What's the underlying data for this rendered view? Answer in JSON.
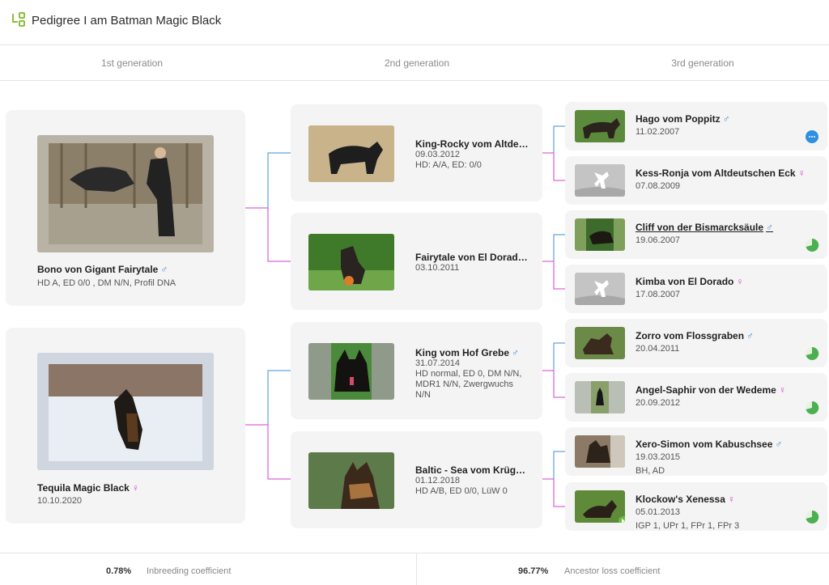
{
  "header": {
    "title": "Pedigree I am Batman Magic Black",
    "logo_icon": "pedigree-tree-icon"
  },
  "generations": [
    "1st generation",
    "2nd generation",
    "3rd generation"
  ],
  "gen1": [
    {
      "name": "Bono von Gigant Fairytale",
      "sex": "♂",
      "detail": "HD A, ED 0/0 , DM N/N, Profil DNA"
    },
    {
      "name": "Tequila Magic Black",
      "sex": "♀",
      "detail": "10.10.2020"
    }
  ],
  "gen2": [
    {
      "name": "King-Rocky vom Altdeut...",
      "sex": "",
      "date": "09.03.2012",
      "detail": "HD: A/A, ED: 0/0"
    },
    {
      "name": "Fairytale von El Dorado",
      "sex": "♀",
      "date": "03.10.2011",
      "detail": ""
    },
    {
      "name": "King vom Hof Grebe",
      "sex": "♂",
      "date": "31.07.2014",
      "detail": "HD normal, ED 0, DM N/N, MDR1 N/N, Zwergwuchs N/N"
    },
    {
      "name": "Baltic - Sea vom Krüger-...",
      "sex": "",
      "date": "01.12.2018",
      "detail": "HD A/B, ED 0/0, LüW 0"
    }
  ],
  "gen3": [
    {
      "name": "Hago vom Poppitz",
      "sex": "♂",
      "date": "11.02.2007",
      "extra": "",
      "status": "info-badge-icon"
    },
    {
      "name": "Kess-Ronja vom Altdeutschen Eck",
      "sex": "♀",
      "date": "07.08.2009",
      "extra": "",
      "status": ""
    },
    {
      "name": "Cliff von der Bismarcksäule",
      "sex": "♂",
      "date": "19.06.2007",
      "extra": "",
      "status": "green-progress-icon"
    },
    {
      "name": "Kimba von El Dorado",
      "sex": "♀",
      "date": "17.08.2007",
      "extra": "",
      "status": ""
    },
    {
      "name": "Zorro vom Flossgraben",
      "sex": "♂",
      "date": "20.04.2011",
      "extra": "",
      "status": "green-progress-icon"
    },
    {
      "name": "Angel-Saphir von der Wedeme",
      "sex": "♀",
      "date": "20.09.2012",
      "extra": "",
      "status": "green-progress-icon"
    },
    {
      "name": "Xero-Simon vom Kabuschsee",
      "sex": "♂",
      "date": "19.03.2015",
      "extra": "BH, AD",
      "status": ""
    },
    {
      "name": "Klockow's Xenessa",
      "sex": "♀",
      "date": "05.01.2013",
      "extra": "IGP 1, UPr 1, FPr 1, FPr 3",
      "status": "green-progress-icon"
    }
  ],
  "footer": {
    "inbreeding_value": "0.78%",
    "inbreeding_label": "Inbreeding coefficient",
    "ancestor_value": "96.77%",
    "ancestor_label": "Ancestor loss coefficient"
  },
  "colors": {
    "male": "#3d8fd6",
    "female": "#d13fd1",
    "accent_green": "#4caf50",
    "card_bg": "#f4f4f4"
  }
}
